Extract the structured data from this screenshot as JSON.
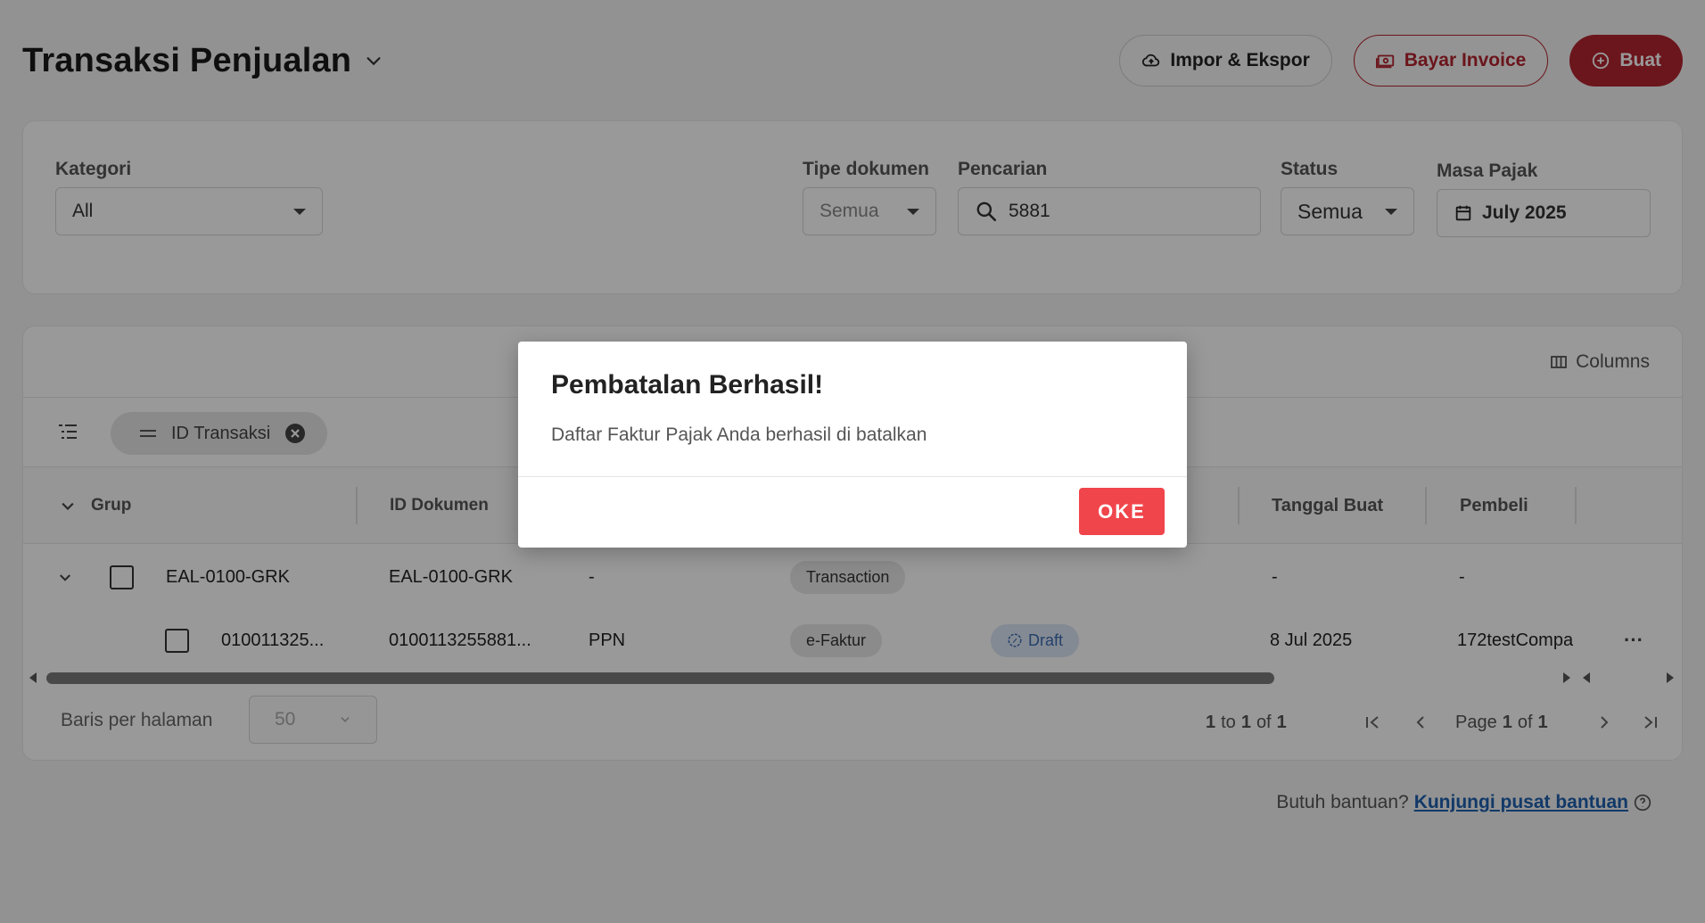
{
  "header": {
    "title": "Transaksi Penjualan",
    "import_export_label": "Impor & Ekspor",
    "pay_invoice_label": "Bayar Invoice",
    "create_label": "Buat"
  },
  "filters": {
    "kategori": {
      "label": "Kategori",
      "value": "All"
    },
    "tipe_dokumen": {
      "label": "Tipe dokumen",
      "value": "Semua"
    },
    "pencarian": {
      "label": "Pencarian",
      "value": "5881"
    },
    "status": {
      "label": "Status",
      "value": "Semua"
    },
    "masa_pajak": {
      "label": "Masa Pajak",
      "value": "July 2025"
    }
  },
  "table": {
    "columns_label": "Columns",
    "group_chip_label": "ID Transaksi",
    "headers": {
      "grup": "Grup",
      "id_dokumen": "ID Dokumen",
      "tanggal_buat": "Tanggal Buat",
      "pembeli": "Pembeli"
    },
    "rows": [
      {
        "group_id": "EAL-0100-GRK",
        "id_dokumen": "EAL-0100-GRK",
        "jenis": "-",
        "tipe": "Transaction",
        "status": "",
        "tanggal": "-",
        "pembeli": "-"
      },
      {
        "group_id": "010011325...",
        "id_dokumen": "0100113255881...",
        "jenis": "PPN",
        "tipe": "e-Faktur",
        "status": "Draft",
        "tanggal": "8 Jul 2025",
        "pembeli": "172testCompa"
      }
    ],
    "pagination": {
      "rows_per_page_label": "Baris per halaman",
      "rows_per_page_value": "50",
      "range_text_pre": "1",
      "range_text_to": "to",
      "range_text_mid": "1",
      "range_text_of": "of",
      "range_text_total": "1",
      "page_label": "Page",
      "page_current": "1",
      "page_of": "of",
      "page_total": "1"
    }
  },
  "help": {
    "prefix": "Butuh bantuan?",
    "link": "Kunjungi pusat bantuan"
  },
  "modal": {
    "title": "Pembatalan Berhasil!",
    "body": "Daftar Faktur Pajak Anda berhasil di batalkan",
    "ok_label": "OKE"
  },
  "colors": {
    "brand_red": "#b3242f",
    "ok_button": "#f0454b",
    "draft_blue": "#3b6db3",
    "link_blue": "#1f5fae"
  }
}
